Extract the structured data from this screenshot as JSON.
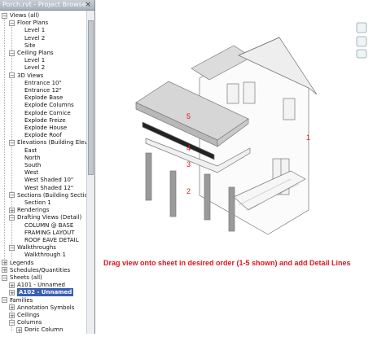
{
  "browser": {
    "title": "Porch.rvt - Project Browser",
    "close": "×",
    "tree": [
      {
        "label": "Views (all)",
        "depth": 0,
        "expander": "−"
      },
      {
        "label": "Floor Plans",
        "depth": 1,
        "expander": "−"
      },
      {
        "label": "Level 1",
        "depth": 2
      },
      {
        "label": "Level 2",
        "depth": 2
      },
      {
        "label": "Site",
        "depth": 2
      },
      {
        "label": "Ceiling Plans",
        "depth": 1,
        "expander": "−"
      },
      {
        "label": "Level 1",
        "depth": 2
      },
      {
        "label": "Level 2",
        "depth": 2
      },
      {
        "label": "3D Views",
        "depth": 1,
        "expander": "−"
      },
      {
        "label": "Entrance 10\"",
        "depth": 2
      },
      {
        "label": "Entrance 12\"",
        "depth": 2
      },
      {
        "label": "Explode Base",
        "depth": 2
      },
      {
        "label": "Explode Columns",
        "depth": 2
      },
      {
        "label": "Explode Cornice",
        "depth": 2
      },
      {
        "label": "Explode Freize",
        "depth": 2
      },
      {
        "label": "Explode House",
        "depth": 2
      },
      {
        "label": "Explode Roof",
        "depth": 2
      },
      {
        "label": "Elevations (Building Elevat",
        "depth": 1,
        "expander": "−"
      },
      {
        "label": "East",
        "depth": 2
      },
      {
        "label": "North",
        "depth": 2
      },
      {
        "label": "South",
        "depth": 2
      },
      {
        "label": "West",
        "depth": 2
      },
      {
        "label": "West Shaded 10\"",
        "depth": 2
      },
      {
        "label": "West Shaded 12\"",
        "depth": 2
      },
      {
        "label": "Sections (Building Section",
        "depth": 1,
        "expander": "−"
      },
      {
        "label": "Section 1",
        "depth": 2
      },
      {
        "label": "Renderings",
        "depth": 1,
        "expander": "+"
      },
      {
        "label": "Drafting Views (Detail)",
        "depth": 1,
        "expander": "−"
      },
      {
        "label": "COLUMN @ BASE",
        "depth": 2
      },
      {
        "label": "FRAMING LAYOUT",
        "depth": 2
      },
      {
        "label": "ROOF EAVE DETAIL",
        "depth": 2
      },
      {
        "label": "Walkthroughs",
        "depth": 1,
        "expander": "−"
      },
      {
        "label": "Walkthrough 1",
        "depth": 2
      },
      {
        "label": "Legends",
        "depth": 0,
        "expander": "+"
      },
      {
        "label": "Schedules/Quantities",
        "depth": 0,
        "expander": "+"
      },
      {
        "label": "Sheets (all)",
        "depth": 0,
        "expander": "−"
      },
      {
        "label": "A101 - Unnamed",
        "depth": 1,
        "expander": "+"
      },
      {
        "label": "A102 - Unnamed",
        "depth": 1,
        "expander": "+",
        "selected": true
      },
      {
        "label": "Families",
        "depth": 0,
        "expander": "−"
      },
      {
        "label": "Annotation Symbols",
        "depth": 1,
        "expander": "+"
      },
      {
        "label": "Ceilings",
        "depth": 1,
        "expander": "+"
      },
      {
        "label": "Columns",
        "depth": 1,
        "expander": "−"
      },
      {
        "label": "Doric Column",
        "depth": 2,
        "expander": "+"
      }
    ]
  },
  "canvas": {
    "instruction": "Drag view onto sheet in desired order (1-5 shown) and add Detail Lines",
    "labels": {
      "n1": "1",
      "n2": "2",
      "n3": "3",
      "n4": "4",
      "n5": "5"
    },
    "label_color": "#e3141b"
  }
}
